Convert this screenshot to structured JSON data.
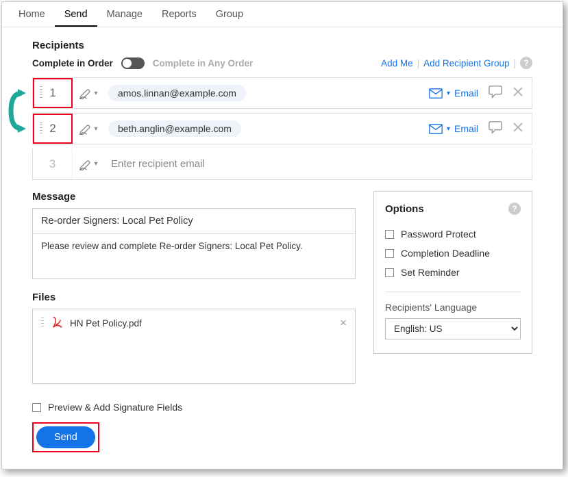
{
  "nav": {
    "tabs": [
      "Home",
      "Send",
      "Manage",
      "Reports",
      "Group"
    ],
    "active_index": 1
  },
  "recipients": {
    "title": "Recipients",
    "order_mode_label": "Complete in Order",
    "alt_order_label": "Complete in Any Order",
    "add_me": "Add Me",
    "add_group": "Add Recipient Group",
    "rows": [
      {
        "order": "1",
        "email": "amos.linnan@example.com",
        "method": "Email"
      },
      {
        "order": "2",
        "email": "beth.anglin@example.com",
        "method": "Email"
      }
    ],
    "placeholder_order": "3",
    "placeholder": "Enter recipient email"
  },
  "message": {
    "title": "Message",
    "subject": "Re-order Signers: Local Pet Policy",
    "body": "Please review and complete Re-order Signers: Local Pet Policy."
  },
  "files": {
    "title": "Files",
    "items": [
      {
        "name": "HN Pet Policy.pdf"
      }
    ]
  },
  "options": {
    "title": "Options",
    "password": "Password Protect",
    "deadline": "Completion Deadline",
    "reminder": "Set Reminder",
    "lang_label": "Recipients' Language",
    "lang_value": "English: US"
  },
  "footer": {
    "preview": "Preview & Add Signature Fields",
    "send": "Send"
  }
}
